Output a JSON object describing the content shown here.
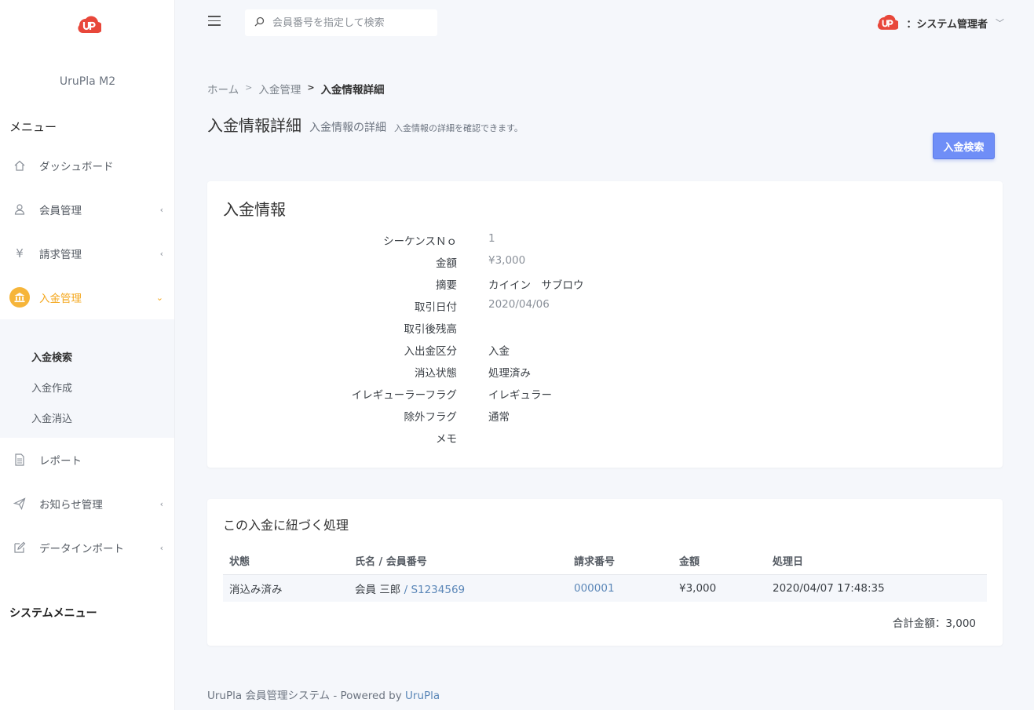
{
  "app": {
    "brand": "UruPla M2"
  },
  "sidebar": {
    "menu_title": "メニュー",
    "items": [
      {
        "label": "ダッシュボード",
        "icon": "home-icon"
      },
      {
        "label": "会員管理",
        "icon": "user-icon"
      },
      {
        "label": "請求管理",
        "icon": "yen-icon"
      },
      {
        "label": "入金管理",
        "icon": "bank-icon"
      },
      {
        "label": "レポート",
        "icon": "document-icon"
      },
      {
        "label": "お知らせ管理",
        "icon": "paper-plane-icon"
      },
      {
        "label": "データインポート",
        "icon": "edit-icon"
      }
    ],
    "submenu": [
      "入金検索",
      "入金作成",
      "入金消込"
    ],
    "system_menu_title": "システムメニュー",
    "accent_color": "#f6b53a"
  },
  "topbar": {
    "search_placeholder": "会員番号を指定して検索",
    "user_name": "：システム管理者"
  },
  "breadcrumb": {
    "home": "ホーム",
    "sep": ">",
    "parent": "入金管理",
    "current": "入金情報詳細"
  },
  "page": {
    "title": "入金情報詳細",
    "subtitle": "入金情報の詳細",
    "description": "入金情報の詳細を確認できます。",
    "search_button": "入金検索"
  },
  "payment_info": {
    "title": "入金情報",
    "fields": [
      {
        "label": "シーケンスＮｏ",
        "value": "1"
      },
      {
        "label": "金額",
        "value": "¥3,000"
      },
      {
        "label": "摘要",
        "value": "カイイン　サブロウ"
      },
      {
        "label": "取引日付",
        "value": "2020/04/06"
      },
      {
        "label": "取引後残高",
        "value": ""
      },
      {
        "label": "入出金区分",
        "value": "入金"
      },
      {
        "label": "消込状態",
        "value": "処理済み"
      },
      {
        "label": "イレギューラーフラグ",
        "value": "イレギュラー"
      },
      {
        "label": "除外フラグ",
        "value": "通常"
      },
      {
        "label": "メモ",
        "value": ""
      }
    ]
  },
  "linked": {
    "title": "この入金に紐づく処理",
    "columns": [
      "状態",
      "氏名 / 会員番号",
      "請求番号",
      "金額",
      "処理日"
    ],
    "rows": [
      {
        "status": "消込み済み",
        "name": "会員 三郎",
        "slash": " / ",
        "member_no": "S1234569",
        "invoice_no": "000001",
        "amount": "¥3,000",
        "date": "2020/04/07 17:48:35"
      }
    ],
    "total": "合計金額：3,000"
  },
  "footer": {
    "text": "UruPla 会員管理システム - Powered by ",
    "link": "UruPla"
  }
}
